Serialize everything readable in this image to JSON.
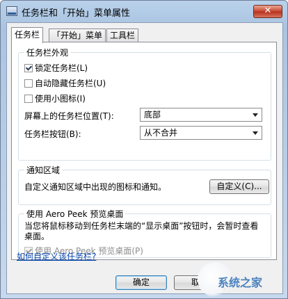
{
  "window": {
    "title": "任务栏和「开始」菜单属性",
    "close_glyph": "✕"
  },
  "tabs": [
    {
      "label": "任务栏",
      "active": true
    },
    {
      "label": "「开始」菜单",
      "active": false
    },
    {
      "label": "工具栏",
      "active": false
    }
  ],
  "appearance": {
    "group_label": "任务栏外观",
    "lock": {
      "label": "锁定任务栏(L)",
      "checked": true
    },
    "autohide": {
      "label": "自动隐藏任务栏(U)",
      "checked": false
    },
    "small_icons": {
      "label": "使用小图标(I)",
      "checked": false
    },
    "position_label": "屏幕上的任务栏位置(T):",
    "position_value": "底部",
    "buttons_label": "任务栏按钮(B):",
    "buttons_value": "从不合并"
  },
  "notification": {
    "group_label": "通知区域",
    "description": "自定义通知区域中出现的图标和通知。",
    "customize_button": "自定义(C)..."
  },
  "aero_peek": {
    "group_label": "使用 Aero Peek 预览桌面",
    "description": "当您将鼠标移动到任务栏末端的“显示桌面”按钮时，会暂时查看桌面。",
    "checkbox_label": "使用 Aero Peek 预览桌面(P)",
    "checked": true,
    "disabled": true
  },
  "help_link": "如何自定义该任务栏?",
  "buttons": {
    "ok": "确定",
    "cancel": "取消"
  },
  "watermark": {
    "text": "系统之家"
  }
}
